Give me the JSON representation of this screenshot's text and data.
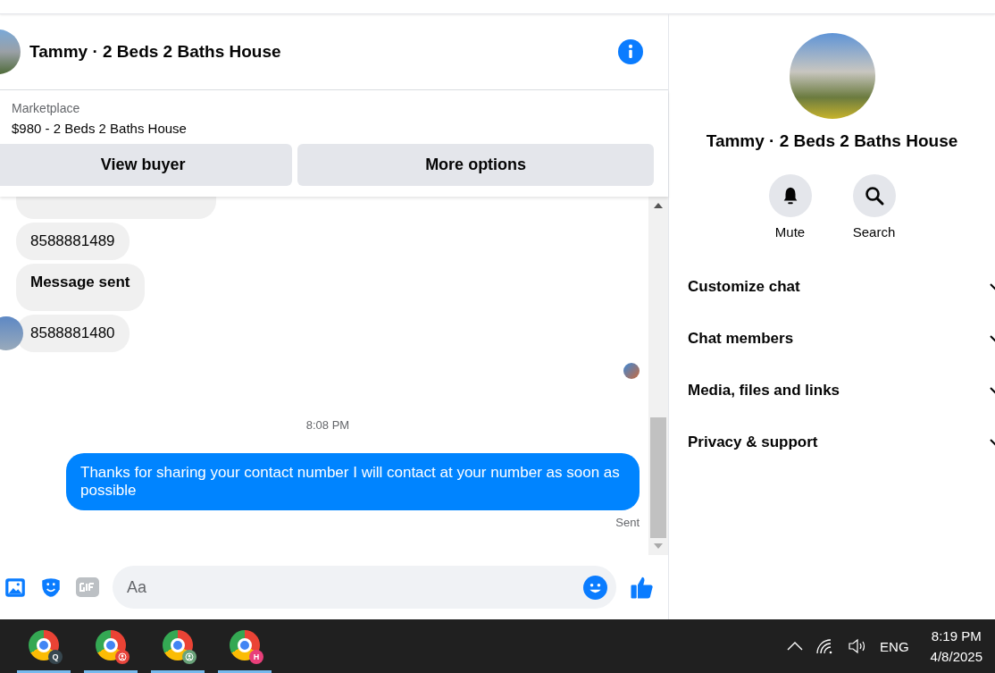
{
  "chat_header": {
    "title": "Tammy · 2 Beds 2 Baths House"
  },
  "listing": {
    "label": "Marketplace",
    "title": "$980 - 2 Beds 2 Baths House",
    "buttons": [
      "View buyer",
      "More options"
    ]
  },
  "messages": [
    {
      "kind": "partial"
    },
    {
      "kind": "received",
      "text": "8588881489",
      "bold": false,
      "avatar": false
    },
    {
      "kind": "received",
      "text": "Message sent",
      "bold": true,
      "avatar": false
    },
    {
      "kind": "received",
      "text": "8588881480",
      "bold": false,
      "avatar": true
    },
    {
      "kind": "seen"
    },
    {
      "kind": "time",
      "text": "8:08 PM"
    },
    {
      "kind": "sent",
      "text": "Thanks for sharing your contact number I will contact at your number as soon as possible"
    },
    {
      "kind": "status",
      "text": "Sent"
    }
  ],
  "composer": {
    "placeholder": "Aa"
  },
  "details": {
    "title": "Tammy · 2 Beds 2 Baths House",
    "actions": [
      {
        "kind": "bell",
        "label": "Mute"
      },
      {
        "kind": "search",
        "label": "Search"
      }
    ],
    "sections": [
      {
        "label": "Customize chat",
        "expanded": false
      },
      {
        "label": "Chat members",
        "expanded": false
      },
      {
        "label": "Media, files and links",
        "expanded": false
      },
      {
        "label": "Privacy & support",
        "expanded": false
      }
    ]
  },
  "taskbar": {
    "apps": [
      {
        "badge": "Q",
        "kind": "letter",
        "color": "#37474f"
      },
      {
        "kind": "person",
        "color": "#e8453c"
      },
      {
        "kind": "person",
        "color": "#6aa37a"
      },
      {
        "badge": "H",
        "kind": "letter",
        "color": "#e83f7a"
      }
    ],
    "language": "ENG",
    "time": "8:19 PM",
    "date": "4/8/2025"
  }
}
